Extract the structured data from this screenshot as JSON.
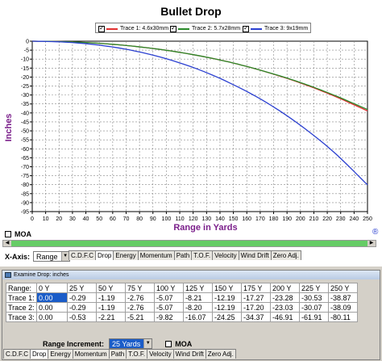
{
  "chart_data": {
    "type": "line",
    "title": "Bullet Drop",
    "xlabel": "Range in Yards",
    "ylabel": "Inches",
    "xlim": [
      0,
      250
    ],
    "ylim": [
      -95,
      0
    ],
    "xticks": [
      0,
      10,
      20,
      30,
      40,
      50,
      60,
      70,
      80,
      90,
      100,
      110,
      120,
      130,
      140,
      150,
      160,
      170,
      180,
      190,
      200,
      210,
      220,
      230,
      240,
      250
    ],
    "yticks": [
      0,
      -5,
      -10,
      -15,
      -20,
      -25,
      -30,
      -35,
      -40,
      -45,
      -50,
      -55,
      -60,
      -65,
      -70,
      -75,
      -80,
      -85,
      -90,
      -95
    ],
    "grid": true,
    "legend_position": "top",
    "series": [
      {
        "name": "Trace 1: 4.6x30mm",
        "color": "#e03030",
        "x": [
          0,
          25,
          50,
          75,
          100,
          125,
          150,
          175,
          200,
          225,
          250
        ],
        "y": [
          0.0,
          -0.29,
          -1.19,
          -2.76,
          -5.07,
          -8.21,
          -12.19,
          -17.27,
          -23.28,
          -30.53,
          -38.87
        ]
      },
      {
        "name": "Trace 2: 5.7x28mm",
        "color": "#2a8a2a",
        "x": [
          0,
          25,
          50,
          75,
          100,
          125,
          150,
          175,
          200,
          225,
          250
        ],
        "y": [
          0.0,
          -0.29,
          -1.19,
          -2.76,
          -5.07,
          -8.2,
          -12.19,
          -17.2,
          -23.03,
          -30.07,
          -38.09
        ]
      },
      {
        "name": "Trace 3: 9x19mm",
        "color": "#2a3fd0",
        "x": [
          0,
          25,
          50,
          75,
          100,
          125,
          150,
          175,
          200,
          225,
          250
        ],
        "y": [
          0.0,
          -0.53,
          -2.21,
          -5.21,
          -9.82,
          -16.07,
          -24.25,
          -34.37,
          -46.91,
          -61.91,
          -80.11
        ]
      }
    ]
  },
  "legend": {
    "items": [
      {
        "label": "Trace 1: 4.6x30mm",
        "checked": true
      },
      {
        "label": "Trace 2: 5.7x28mm",
        "checked": true
      },
      {
        "label": "Trace 3: 9x19mm",
        "checked": true
      }
    ]
  },
  "moa_label": "MOA",
  "reset_icon": "®",
  "xaxis": {
    "label": "X-Axis:",
    "selected": "Range"
  },
  "top_tabs": [
    "C.D.F.C",
    "Drop",
    "Energy",
    "Momentum",
    "Path",
    "T.O.F.",
    "Velocity",
    "Wind Drift",
    "Zero Adj."
  ],
  "top_active_tab": "Drop",
  "window_title": "Examine Drop: inches",
  "table": {
    "headers": [
      "Range:",
      "0 Y",
      "25 Y",
      "50 Y",
      "75 Y",
      "100 Y",
      "125 Y",
      "150 Y",
      "175 Y",
      "200 Y",
      "225 Y",
      "250 Y"
    ],
    "rows": [
      {
        "label": "Trace 1:",
        "values": [
          "0.00",
          "-0.29",
          "-1.19",
          "-2.76",
          "-5.07",
          "-8.21",
          "-12.19",
          "-17.27",
          "-23.28",
          "-30.53",
          "-38.87"
        ]
      },
      {
        "label": "Trace 2:",
        "values": [
          "0.00",
          "-0.29",
          "-1.19",
          "-2.76",
          "-5.07",
          "-8.20",
          "-12.19",
          "-17.20",
          "-23.03",
          "-30.07",
          "-38.09"
        ]
      },
      {
        "label": "Trace 3:",
        "values": [
          "0.00",
          "-0.53",
          "-2.21",
          "-5.21",
          "-9.82",
          "-16.07",
          "-24.25",
          "-34.37",
          "-46.91",
          "-61.91",
          "-80.11"
        ]
      }
    ]
  },
  "range_increment": {
    "label": "Range Increment:",
    "selected": "25 Yards"
  },
  "bottom_moa_label": "MOA",
  "bottom_tabs": [
    "C.D.F.C",
    "Drop",
    "Energy",
    "Momentum",
    "Path",
    "T.O.F.",
    "Velocity",
    "Wind Drift",
    "Zero Adj."
  ],
  "bottom_active_tab": "Drop"
}
